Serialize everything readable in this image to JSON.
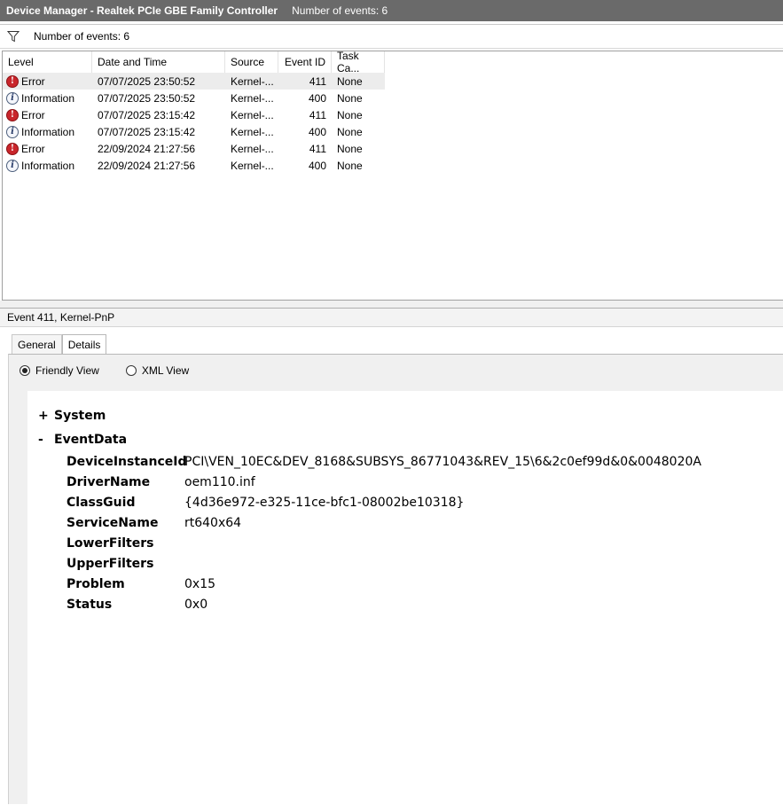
{
  "window": {
    "title": "Device Manager - Realtek PCIe GBE Family Controller",
    "event_count_label": "Number of events: 6"
  },
  "toolbar": {
    "filter_icon": "filter-icon",
    "event_count_label": "Number of events: 6"
  },
  "table": {
    "columns": [
      "Level",
      "Date and Time",
      "Source",
      "Event ID",
      "Task Ca..."
    ],
    "rows": [
      {
        "icon": "error",
        "level": "Error",
        "datetime": "07/07/2025 23:50:52",
        "source": "Kernel-...",
        "event_id": "411",
        "task": "None"
      },
      {
        "icon": "info",
        "level": "Information",
        "datetime": "07/07/2025 23:50:52",
        "source": "Kernel-...",
        "event_id": "400",
        "task": "None"
      },
      {
        "icon": "error",
        "level": "Error",
        "datetime": "07/07/2025 23:15:42",
        "source": "Kernel-...",
        "event_id": "411",
        "task": "None"
      },
      {
        "icon": "info",
        "level": "Information",
        "datetime": "07/07/2025 23:15:42",
        "source": "Kernel-...",
        "event_id": "400",
        "task": "None"
      },
      {
        "icon": "error",
        "level": "Error",
        "datetime": "22/09/2024 21:27:56",
        "source": "Kernel-...",
        "event_id": "411",
        "task": "None"
      },
      {
        "icon": "info",
        "level": "Information",
        "datetime": "22/09/2024 21:27:56",
        "source": "Kernel-...",
        "event_id": "400",
        "task": "None"
      }
    ]
  },
  "details": {
    "title": "Event 411, Kernel-PnP",
    "tabs": {
      "general": "General",
      "details": "Details"
    },
    "view_options": {
      "friendly": "Friendly View",
      "xml": "XML View",
      "selected": "friendly"
    },
    "system": {
      "sign": "+",
      "label": "System"
    },
    "eventdata": {
      "sign": "-",
      "label": "EventData",
      "fields": [
        {
          "key": "DeviceInstanceId",
          "value": "PCI\\VEN_10EC&DEV_8168&SUBSYS_86771043&REV_15\\6&2c0ef99d&0&0048020A"
        },
        {
          "key": "DriverName",
          "value": "oem110.inf"
        },
        {
          "key": "ClassGuid",
          "value": "{4d36e972-e325-11ce-bfc1-08002be10318}"
        },
        {
          "key": "ServiceName",
          "value": "rt640x64"
        },
        {
          "key": "LowerFilters",
          "value": ""
        },
        {
          "key": "UpperFilters",
          "value": ""
        },
        {
          "key": "Problem",
          "value": "0x15"
        },
        {
          "key": "Status",
          "value": "0x0"
        }
      ]
    }
  },
  "colors": {
    "titlebar": "#6a6a6a",
    "error_icon": "#c9252b",
    "info_icon_border": "#4d5f7c",
    "selected_row": "#ececec"
  }
}
